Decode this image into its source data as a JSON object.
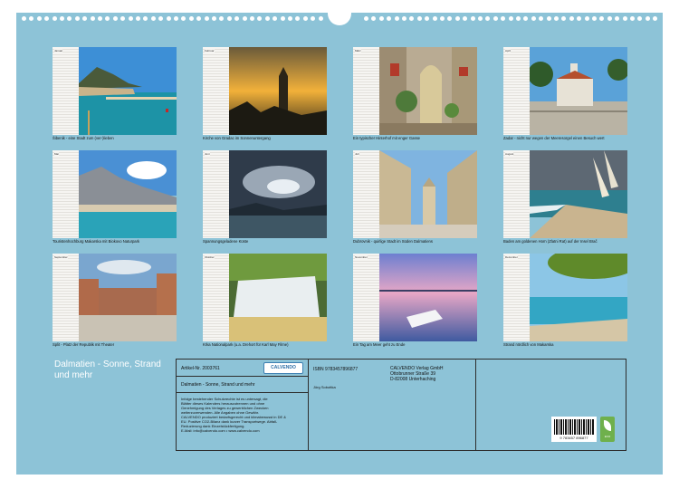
{
  "title": "Dalmatien - Sonne, Strand und mehr",
  "months": [
    {
      "month": "Januar",
      "caption": "Šibenik - eine Stadt zum (ver-)lieben"
    },
    {
      "month": "Februar",
      "caption": "Kirche von Gradac im Sonnenuntergang"
    },
    {
      "month": "März",
      "caption": "Ein typischer Hinterhof mit enger Gasse"
    },
    {
      "month": "April",
      "caption": "Zadar - nicht nur wegen der Meeresorgel einen Besuch wert"
    },
    {
      "month": "Mai",
      "caption": "Touristenhochburg Makarska mit Biokovo Naturpark"
    },
    {
      "month": "Juni",
      "caption": "Spannungsgeladene Küste"
    },
    {
      "month": "Juli",
      "caption": "Dubrovnik - quirlige Stadt im Süden Dalmatiens"
    },
    {
      "month": "August",
      "caption": "Baden am goldenen Horn (Zlatni Rat) auf der Insel Brač"
    },
    {
      "month": "September",
      "caption": "Split - Platz der Republik mit Theater"
    },
    {
      "month": "Oktober",
      "caption": "Krka Nationalpark (u.a. Drehort für Karl May Filme)"
    },
    {
      "month": "November",
      "caption": "Ein Tag am Meer geht zu Ende"
    },
    {
      "month": "Dezember",
      "caption": "Strand nördlich von Makarska"
    }
  ],
  "info": {
    "article": "Artikel-Nr. 2003761",
    "logo": "CALVENDO",
    "subtitle": "Dalmatien - Sonne, Strand und mehr",
    "legal": [
      "Infolge bestehender Schutzrechte ist es untersagt, die",
      "Blätter dieses Kalenders herauszutrennen und ohne",
      "Genehmigung des Verlages zu gewerblichen Zwecken",
      "weiterzuverwenden. Alle Angaben ohne Gewähr.",
      "CALVENDO produziert bedarfsgerecht und klimabewusst in DE &",
      "EU. Positive CO2-Bilanz dank kurzer Transportwege. Abfall-",
      "Reduzierung dank Einzelstückfertigung.",
      "E-Mail: info@calvendo.com • www.calvendo.com"
    ],
    "isbn": "ISBN 9783457896877",
    "author": "Jörg Sobottka",
    "publisher": [
      "CALVENDO Verlag GmbH",
      "Ottobrunner Straße 39",
      "D-82008 Unterhaching"
    ],
    "barcode_number": "9 783457 896877",
    "eco_label": "ECO"
  },
  "colors": {
    "background": "#8dc3d7",
    "frame": "#2d2d2d",
    "logo_blue": "#2d6ea5",
    "eco_green": "#6fb04c"
  }
}
